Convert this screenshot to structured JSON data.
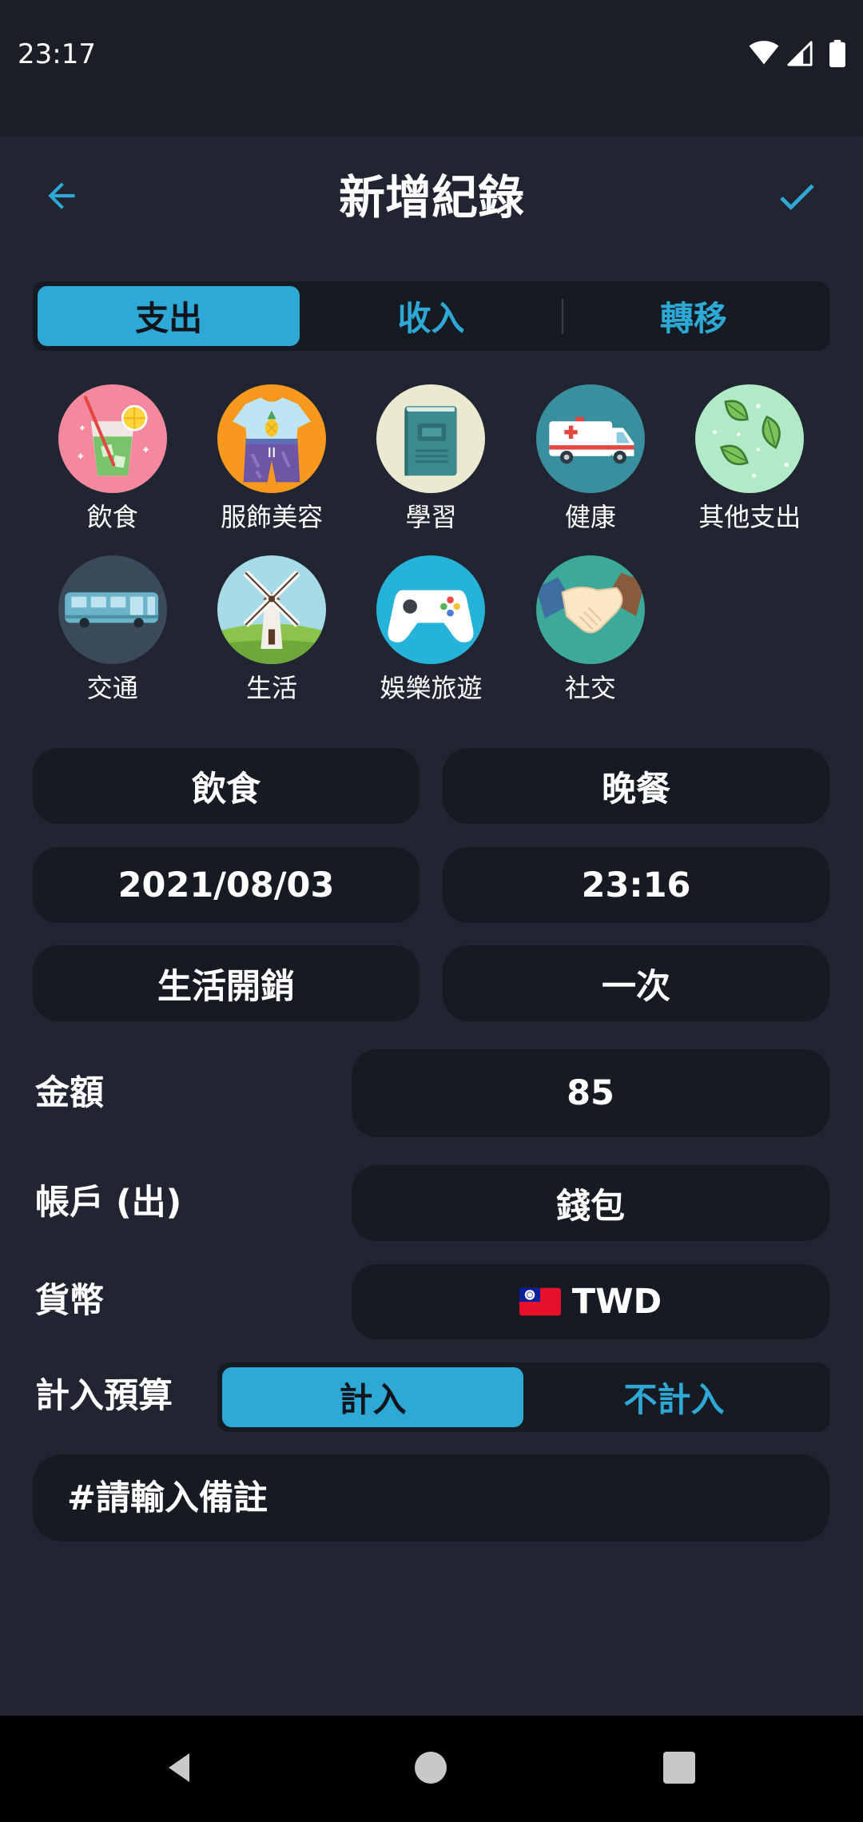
{
  "theme": {
    "accent": "#2ea9d6",
    "background": "#212532",
    "field": "#161a22",
    "status_bar": "#1b1e26",
    "nav_bar": "#000000"
  },
  "status_bar": {
    "time": "23:17",
    "icons": [
      "wifi-icon",
      "cellular-signal-icon",
      "battery-icon"
    ]
  },
  "header": {
    "title": "新增紀錄",
    "back_icon": "arrow-left-icon",
    "confirm_icon": "check-icon"
  },
  "type_tabs": {
    "options": [
      "支出",
      "收入",
      "轉移"
    ],
    "selected_index": 0
  },
  "categories": [
    {
      "label": "飲食",
      "icon": "drink-icon",
      "color": "#f4889e"
    },
    {
      "label": "服飾美容",
      "icon": "clothes-icon",
      "color": "#f6991d"
    },
    {
      "label": "學習",
      "icon": "book-icon",
      "color": "#ebead0"
    },
    {
      "label": "健康",
      "icon": "ambulance-icon",
      "color": "#3a8f9e"
    },
    {
      "label": "其他支出",
      "icon": "leaves-icon",
      "color": "#b0eac6"
    },
    {
      "label": "交通",
      "icon": "bus-icon",
      "color": "#3a4a5a"
    },
    {
      "label": "生活",
      "icon": "windmill-icon",
      "color": "#a8dbe8"
    },
    {
      "label": "娛樂旅遊",
      "icon": "gamepad-icon",
      "color": "#26b3da"
    },
    {
      "label": "社交",
      "icon": "handshake-icon",
      "color": "#3da99a"
    }
  ],
  "details": {
    "category": "飲食",
    "subcategory": "晚餐",
    "date": "2021/08/03",
    "time": "23:16",
    "project": "生活開銷",
    "frequency": "一次"
  },
  "form": {
    "amount": {
      "label": "金額",
      "value": "85"
    },
    "account": {
      "label": "帳戶 (出)",
      "value": "錢包"
    },
    "currency": {
      "label": "貨幣",
      "flag_icon": "taiwan-flag-icon",
      "value": "TWD"
    },
    "budget": {
      "label": "計入預算",
      "options": [
        "計入",
        "不計入"
      ],
      "selected_index": 0
    },
    "note": {
      "placeholder": "#請輸入備註"
    }
  },
  "nav_bar": {
    "icons": [
      "nav-back-icon",
      "nav-home-icon",
      "nav-recents-icon"
    ]
  }
}
